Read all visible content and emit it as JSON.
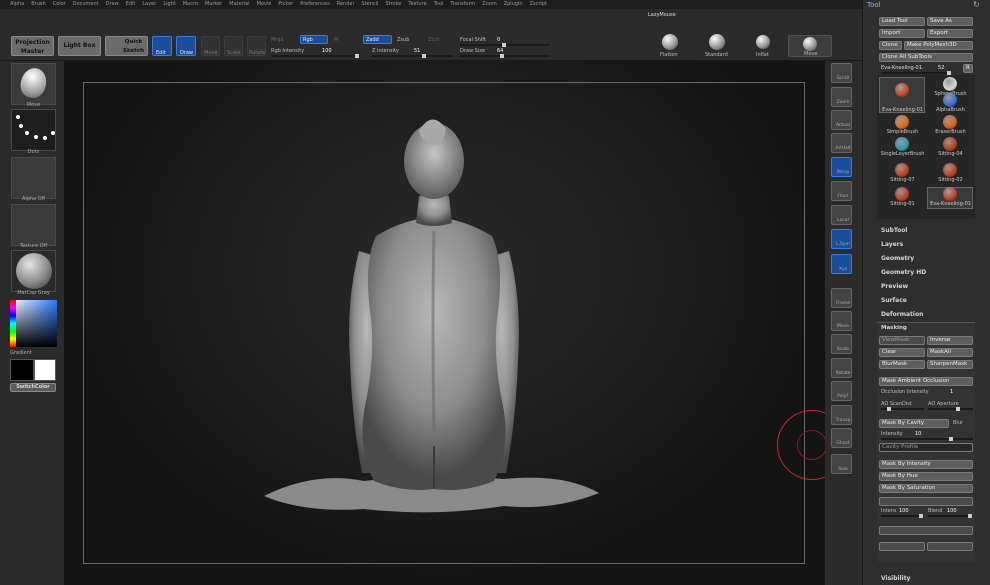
{
  "menu": [
    "Alpha",
    "Brush",
    "Color",
    "Document",
    "Draw",
    "Edit",
    "Layer",
    "Light",
    "Macro",
    "Marker",
    "Material",
    "Movie",
    "Picker",
    "Preferences",
    "Render",
    "Stencil",
    "Stroke",
    "Texture",
    "Tool",
    "Transform",
    "Zoom",
    "Zplugin",
    "Zscript"
  ],
  "lazymouse": "LazyMouse",
  "toolbar": {
    "projection_master": "Projection Master",
    "light_box": "Light Box",
    "quick_sketch": "Quick Sketch",
    "edit": "Edit",
    "draw": "Draw",
    "move": "Move",
    "scale": "Scale",
    "rotate": "Rotate",
    "mrgb": "Mrgb",
    "rgb": "Rgb",
    "m": "M",
    "zadd": "Zadd",
    "zsub": "Zsub",
    "zcut": "Zcut",
    "rgb_intensity_label": "Rgb Intensity",
    "rgb_intensity_value": "100",
    "z_intensity_label": "Z Intensity",
    "z_intensity_value": "51",
    "focal_shift_label": "Focal Shift",
    "focal_shift_value": "0",
    "draw_size_label": "Draw Size",
    "draw_size_value": "64",
    "flatten": "Flatten",
    "standard": "Standard",
    "inflat": "Inflat",
    "move_brush": "Move"
  },
  "left": {
    "brush": "Move",
    "stroke": "Dots",
    "alpha": "Alpha Off",
    "texture": "Texture Off",
    "material": "MatCap Gray",
    "gradient": "Gradient",
    "switch_color": "SwitchColor"
  },
  "right": [
    "Scroll",
    "Zoom",
    "Actual",
    "AAHalf",
    "Persp",
    "Floor",
    "Local",
    "L.Sym",
    "Xyz",
    "Frame",
    "Move",
    "Scale",
    "Rotate",
    "PolyF",
    "Transp",
    "Ghost",
    "Solo"
  ],
  "tool": {
    "title": "Tool",
    "load_tool": "Load Tool",
    "save_as": "Save As",
    "import": "Import",
    "export": "Export",
    "clone": "Clone",
    "make_polymesh": "Make PolyMesh3D",
    "clone_all": "Clone All SubTools",
    "current_tool": "Eva-Kneeling-01.",
    "current_num": "52",
    "r_btn": "R",
    "brushes": [
      {
        "name": "Eva-Kneeling-01"
      },
      {
        "name": "SphereBrush"
      },
      {
        "name": "AlphaBrush"
      },
      {
        "name": "SimpleBrush"
      },
      {
        "name": "EraserBrush"
      },
      {
        "name": "SingleLayerBrush"
      },
      {
        "name": "Sitting-04"
      },
      {
        "name": "Sitting-07"
      },
      {
        "name": "Sitting-02"
      },
      {
        "name": "Sitting-01"
      },
      {
        "name": "Eva-Kneeling-01"
      }
    ],
    "sections": [
      "SubTool",
      "Layers",
      "Geometry",
      "Geometry HD",
      "Preview",
      "Surface",
      "Deformation"
    ],
    "masking": "Masking",
    "view_mask": "ViewMask",
    "inverse": "Inverse",
    "clear": "Clear",
    "mask_all": "MaskAll",
    "blur_mask": "BlurMask",
    "sharpen_mask": "SharpenMask",
    "mask_ao": "Mask Ambient Occlusion",
    "occlusion_intensity": "Occlusion Intensity",
    "occlusion_value": "1",
    "ao_scandist": "AO ScanDist",
    "ao_aperture": "AO Aperture",
    "mask_by_cavity": "Mask By Cavity",
    "blur": "Blur",
    "intensity_label": "Intensity",
    "intensity_value": "10",
    "cavity_profile": "Cavity Profile",
    "mask_by_intensity": "Mask By Intensity",
    "mask_by_hue": "Mask By Hue",
    "mask_by_saturation": "Mask By Saturation",
    "intens_label": "Intens",
    "intens_value": "100",
    "blend_label": "Blend",
    "blend_value": "100",
    "visibility": "Visibility"
  }
}
